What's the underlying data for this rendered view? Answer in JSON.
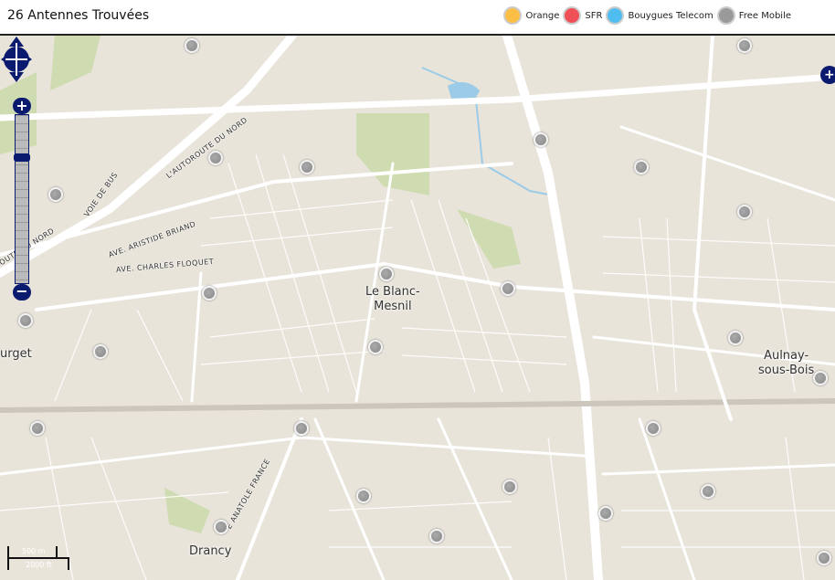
{
  "header": {
    "title": "26 Antennes Trouvées"
  },
  "legend": [
    {
      "label": "Orange",
      "color": "#fbbf45"
    },
    {
      "label": "SFR",
      "color": "#ef4f57"
    },
    {
      "label": "Bouygues Telecom",
      "color": "#4fbdf0"
    },
    {
      "label": "Free Mobile",
      "color": "#9a9a9a"
    }
  ],
  "map": {
    "places": {
      "blanc_mesnil": "Le Blanc-\nMesnil",
      "aulnay": "Aulnay-\nsous-Bois",
      "drancy": "Drancy",
      "bourget": "urget"
    },
    "streets": {
      "autoroute1": "L'AUTOROUTE DU NORD",
      "autoroute2": "OUTE DU NORD",
      "voie_bus": "VOIE DE BUS",
      "briand": "AVE. ARISTIDE BRIAND",
      "floquet": "AVE. CHARLES FLOQUET",
      "france": "E ANATOLE FRANCE"
    },
    "antenna_count": 26,
    "scale": {
      "metric": "500 m",
      "imperial": "2000 ft"
    }
  }
}
